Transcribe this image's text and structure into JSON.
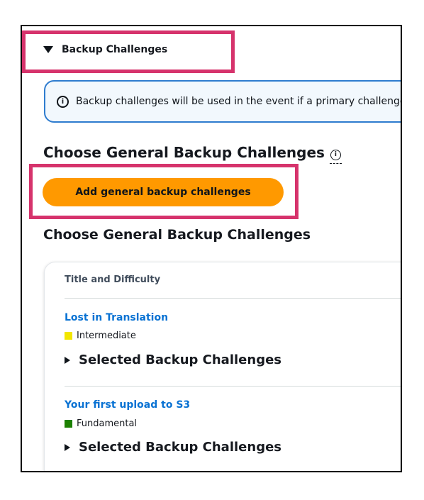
{
  "section": {
    "title": "Backup Challenges",
    "toggle_icon": "caret-down-icon"
  },
  "info": {
    "icon": "info-icon",
    "text": "Backup challenges will be used in the event if a primary challenge"
  },
  "general": {
    "heading": "Choose General Backup Challenges",
    "add_button_label": "Add general backup challenges",
    "list_heading": "Choose General Backup Challenges"
  },
  "table": {
    "column_header": "Title and Difficulty",
    "rows": [
      {
        "title": "Lost in Translation",
        "level": "Intermediate",
        "level_color": "#f2e600",
        "expander": "Selected Backup Challenges"
      },
      {
        "title": "Your first upload to S3",
        "level": "Fundamental",
        "level_color": "#1d8102",
        "expander": "Selected Backup Challenges"
      }
    ]
  },
  "colors": {
    "highlight": "#d6336c",
    "primary_button": "#ff9900",
    "link": "#0972d3",
    "info_border": "#2e7ccf"
  }
}
